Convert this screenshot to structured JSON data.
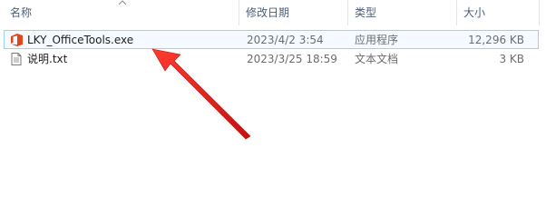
{
  "columns": {
    "name": "名称",
    "date": "修改日期",
    "type": "类型",
    "size": "大小"
  },
  "files": [
    {
      "name": "LKY_OfficeTools.exe",
      "date": "2023/4/2 3:54",
      "type": "应用程序",
      "size": "12,296 KB",
      "icon": "office-app-icon",
      "selected": true
    },
    {
      "name": "说明.txt",
      "date": "2023/3/25 18:59",
      "type": "文本文档",
      "size": "3 KB",
      "icon": "text-document-icon",
      "selected": false
    }
  ],
  "colors": {
    "selection_border": "#99d1ff",
    "selection_fill": "#f4faff",
    "arrow": "#e8201c",
    "office_icon": "#e2471a"
  }
}
